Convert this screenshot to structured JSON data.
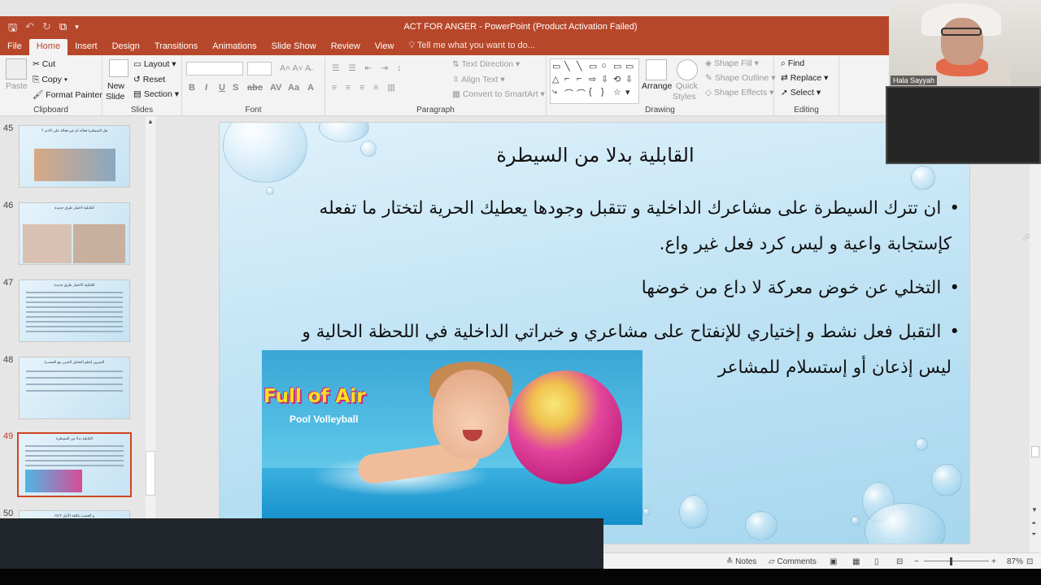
{
  "window": {
    "title": "ACT FOR ANGER - PowerPoint (Product Activation Failed)"
  },
  "tabs": [
    "File",
    "Home",
    "Insert",
    "Design",
    "Transitions",
    "Animations",
    "Slide Show",
    "Review",
    "View"
  ],
  "tell_me": "Tell me what you want to do...",
  "ribbon": {
    "clipboard": {
      "paste": "Paste",
      "cut": "Cut",
      "copy": "Copy",
      "format_painter": "Format Painter",
      "label": "Clipboard"
    },
    "slides": {
      "new_slide_1": "New",
      "new_slide_2": "Slide",
      "layout": "Layout",
      "reset": "Reset",
      "section": "Section",
      "label": "Slides"
    },
    "font": {
      "label": "Font"
    },
    "paragraph": {
      "text_direction": "Text Direction",
      "align_text": "Align Text",
      "convert_smartart": "Convert to SmartArt",
      "label": "Paragraph"
    },
    "drawing": {
      "arrange": "Arrange",
      "quick_styles_1": "Quick",
      "quick_styles_2": "Styles",
      "shape_fill": "Shape Fill",
      "shape_outline": "Shape Outline",
      "shape_effects": "Shape Effects",
      "label": "Drawing"
    },
    "editing": {
      "find": "Find",
      "replace": "Replace",
      "select": "Select",
      "label": "Editing"
    }
  },
  "thumbnails": [
    {
      "number": "45",
      "title": "هل السيطرة فعالة ام غير فعالة على الاذى ؟"
    },
    {
      "number": "46",
      "title": "القابلية لاختيار طرق جديدة"
    },
    {
      "number": "47",
      "title": "القابلية الاختيار طرق جديدة"
    },
    {
      "number": "48",
      "title": "التمرين (تعلم التعامل التحرر مع الغضب)"
    },
    {
      "number": "49",
      "title": "القابلية بدلا من السيطرة"
    },
    {
      "number": "50",
      "title": "ACT و الغضب باللغة الأمل"
    }
  ],
  "slide": {
    "title": "القابلية بدلا من السيطرة",
    "bullet1_line1": "ان تترك السيطرة على مشاعرك الداخلية و تتقبل وجودها يعطيك الحرية لتختار ما تفعله",
    "bullet1_line2": "كإستجابة واعية و ليس كرد فعل غير واع.",
    "bullet2": "التخلي عن خوض معركة لا داع من خوضها",
    "bullet3_line1": "التقبل فعل نشط و إختياري للإنفتاح على مشاعري و خبراتي الداخلية في اللحظة الحالية و",
    "bullet3_line2": "ليس إذعان أو إستسلام للمشاعر",
    "image_brand": "Full of Air",
    "image_sub": "Pool Volleyball"
  },
  "status": {
    "notes": "Notes",
    "comments": "Comments",
    "zoom": "87%"
  },
  "video": {
    "participant": "Hala Sayyah"
  }
}
